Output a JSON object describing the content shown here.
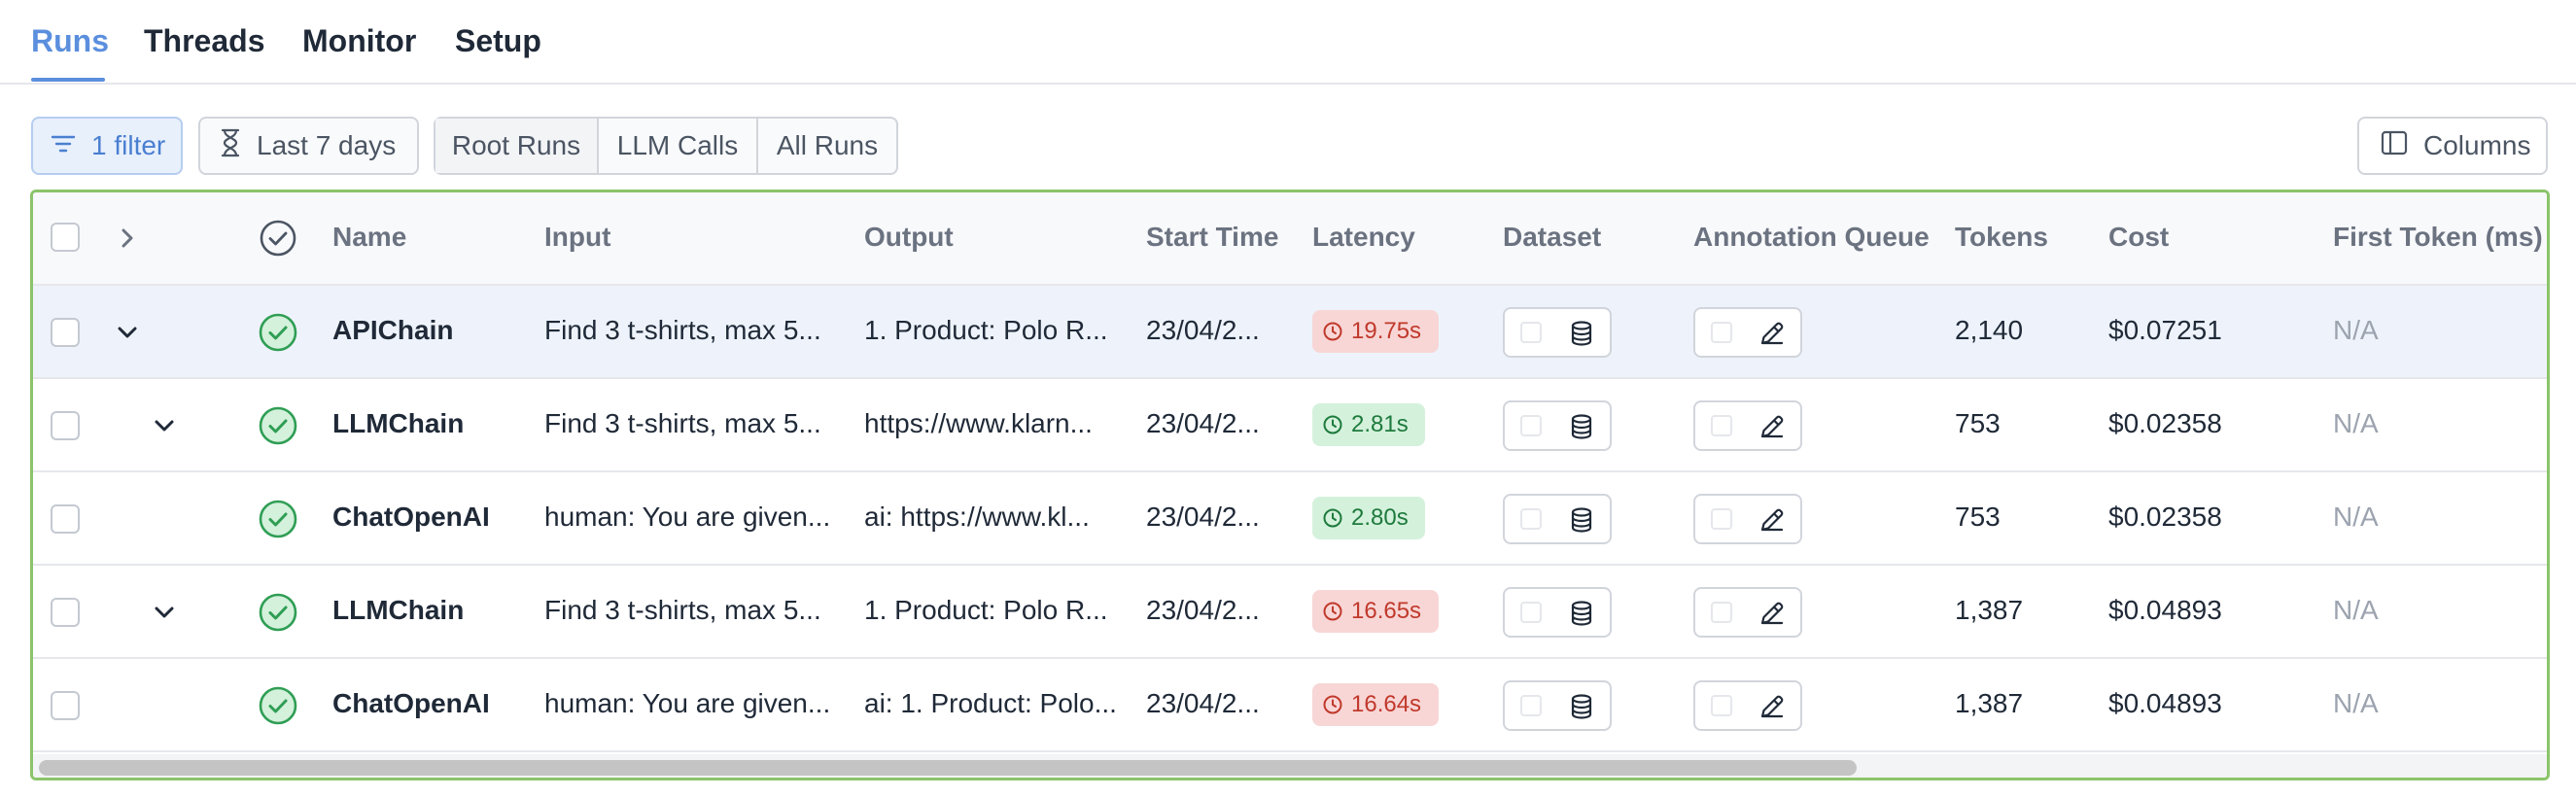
{
  "tabs": [
    {
      "label": "Runs",
      "active": true
    },
    {
      "label": "Threads",
      "active": false
    },
    {
      "label": "Monitor",
      "active": false
    },
    {
      "label": "Setup",
      "active": false
    }
  ],
  "toolbar": {
    "filter_label": "1 filter",
    "filter_icon": "filter-icon",
    "date_label": "Last 7 days",
    "date_icon": "hourglass-icon",
    "segments": [
      {
        "label": "Root Runs",
        "selected": true
      },
      {
        "label": "LLM Calls",
        "selected": false
      },
      {
        "label": "All Runs",
        "selected": false
      }
    ],
    "columns_label": "Columns",
    "columns_icon": "columns-icon"
  },
  "table": {
    "headers": {
      "name": "Name",
      "input": "Input",
      "output": "Output",
      "start_time": "Start Time",
      "latency": "Latency",
      "dataset": "Dataset",
      "annotation_queue": "Annotation Queue",
      "tokens": "Tokens",
      "cost": "Cost",
      "first_token": "First Token (ms)"
    },
    "rows": [
      {
        "name": "APIChain",
        "input": "Find 3 t-shirts, max 5...",
        "output": "1. Product: Polo R...",
        "start": "23/04/2...",
        "latency": "19.75s",
        "latency_status": "slow",
        "tokens": "2,140",
        "cost": "$0.07251",
        "first_token": "N/A",
        "expand": "expanded",
        "depth": 0,
        "status": "success",
        "selected": true
      },
      {
        "name": "LLMChain",
        "input": "Find 3 t-shirts, max 5...",
        "output": "https://www.klarn...",
        "start": "23/04/2...",
        "latency": "2.81s",
        "latency_status": "fast",
        "tokens": "753",
        "cost": "$0.02358",
        "first_token": "N/A",
        "expand": "expanded",
        "depth": 1,
        "status": "success",
        "selected": false
      },
      {
        "name": "ChatOpenAI",
        "input": "human: You are given...",
        "output": "ai: https://www.kl...",
        "start": "23/04/2...",
        "latency": "2.80s",
        "latency_status": "fast",
        "tokens": "753",
        "cost": "$0.02358",
        "first_token": "N/A",
        "expand": "none",
        "depth": 2,
        "status": "success",
        "selected": false
      },
      {
        "name": "LLMChain",
        "input": "Find 3 t-shirts, max 5...",
        "output": "1. Product: Polo R...",
        "start": "23/04/2...",
        "latency": "16.65s",
        "latency_status": "slow",
        "tokens": "1,387",
        "cost": "$0.04893",
        "first_token": "N/A",
        "expand": "expanded",
        "depth": 1,
        "status": "success",
        "selected": false
      },
      {
        "name": "ChatOpenAI",
        "input": "human: You are given...",
        "output": "ai: 1. Product: Polo...",
        "start": "23/04/2...",
        "latency": "16.64s",
        "latency_status": "slow",
        "tokens": "1,387",
        "cost": "$0.04893",
        "first_token": "N/A",
        "expand": "none",
        "depth": 2,
        "status": "success",
        "selected": false
      }
    ]
  },
  "colors": {
    "accent": "#5b8fde",
    "frame_border": "#8bc46a",
    "success": "#2f9e54",
    "slow_bg": "#f8d6d6",
    "slow_text": "#c0392b",
    "fast_bg": "#d4f1dc",
    "fast_text": "#1e7a3c"
  }
}
